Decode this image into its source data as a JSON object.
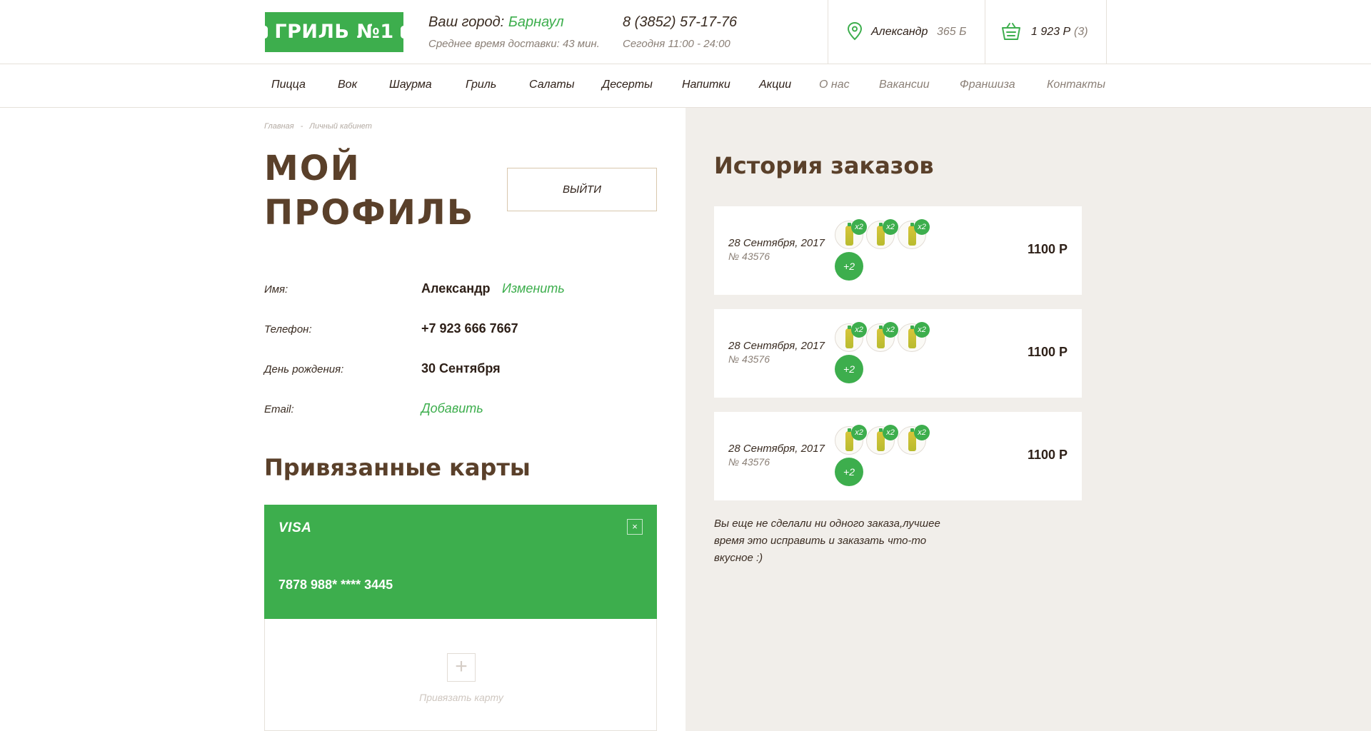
{
  "header": {
    "logo_text": "ГРИЛЬ №1",
    "city_label": "Ваш город:",
    "city_name": "Барнаул",
    "delivery_time": "Среднее время доставки: 43 мин.",
    "phone": "8 (3852) 57-17-76",
    "hours": "Сегодня 11:00 - 24:00",
    "user_name": "Александр",
    "user_points": "365 Б",
    "cart_total": "1 923 Р",
    "cart_count": "(3)"
  },
  "nav": {
    "items": [
      "Пицца",
      "Вок",
      "Шаурма",
      "Гриль",
      "Салаты",
      "Десерты",
      "Напитки",
      "Акции",
      "О нас",
      "Вакансии",
      "Франшиза",
      "Контакты"
    ]
  },
  "breadcrumb": {
    "home": "Главная",
    "sep": "-",
    "current": "Личный кабинет"
  },
  "profile": {
    "title_line1": "МОЙ",
    "title_line2": "ПРОФИЛЬ",
    "logout": "ВЫЙТИ",
    "fields": [
      {
        "label": "Имя:",
        "value": "Александр",
        "action": "Изменить"
      },
      {
        "label": "Телефон:",
        "value": "+7 923 666 7667"
      },
      {
        "label": "День рождения:",
        "value": "30 Сентября"
      },
      {
        "label": "Email:",
        "action": "Добавить"
      }
    ]
  },
  "cards": {
    "title": "Привязанные карты",
    "items": [
      {
        "brand": "VISA",
        "number": "7878 988* **** 3445",
        "close": "×"
      }
    ],
    "add_label": "Привязать карту",
    "add_symbol": "+"
  },
  "orders": {
    "title": "История заказов",
    "items": [
      {
        "date": "28 Сентября, 2017",
        "number": "№ 43576",
        "price": "1100 Р",
        "products": [
          "x2",
          "x2",
          "x2"
        ],
        "more": "+2"
      },
      {
        "date": "28 Сентября, 2017",
        "number": "№ 43576",
        "price": "1100 Р",
        "products": [
          "x2",
          "x2",
          "x2"
        ],
        "more": "+2"
      },
      {
        "date": "28 Сентября, 2017",
        "number": "№ 43576",
        "price": "1100 Р",
        "products": [
          "x2",
          "x2",
          "x2"
        ],
        "more": "+2"
      }
    ],
    "empty_text": "Вы еще не сделали ни одного заказа,лучшее время это исправить и заказать что-то вкусное :)"
  },
  "colors": {
    "accent": "#3dae4d",
    "brown": "#5a402a",
    "panel": "#f1eeea"
  },
  "icons": {
    "user": "location-pin-icon",
    "cart": "basket-icon"
  }
}
